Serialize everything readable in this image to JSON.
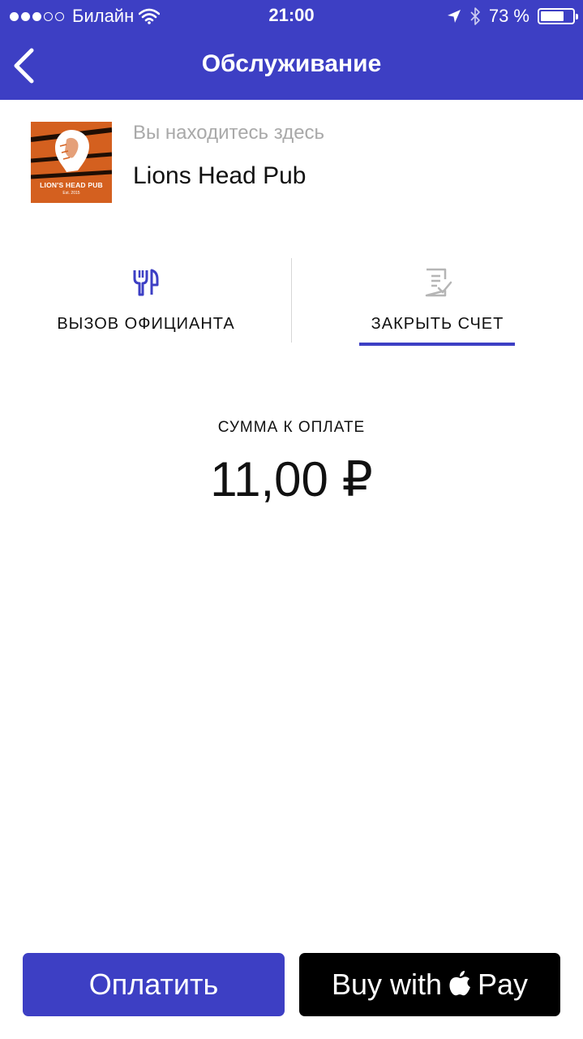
{
  "status_bar": {
    "carrier": "Билайн",
    "time": "21:00",
    "battery": "73 %",
    "battery_level": 0.73,
    "signal_bars_filled": 3,
    "signal_bars_total": 5
  },
  "nav": {
    "title": "Обслуживание"
  },
  "venue": {
    "caption": "Вы находитесь здесь",
    "name": "Lions Head Pub",
    "logo_text": "LION'S HEAD PUB",
    "logo_sub": "Est. 2015"
  },
  "tabs": [
    {
      "label": "ВЫЗОВ ОФИЦИАНТА",
      "icon": "cutlery-icon",
      "active": false
    },
    {
      "label": "ЗАКРЫТЬ СЧЕТ",
      "icon": "bill-check-icon",
      "active": true
    }
  ],
  "payment": {
    "amount_label": "СУММА К ОПЛАТЕ",
    "amount": "11,00 ₽"
  },
  "buttons": {
    "pay_label": "Оплатить",
    "applepay_prefix": "Buy with",
    "applepay_suffix": "Pay"
  },
  "colors": {
    "accent": "#3d3fc4",
    "logo_bg": "#d4601f",
    "caption_gray": "#a9a9a9"
  }
}
